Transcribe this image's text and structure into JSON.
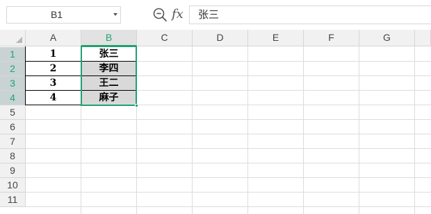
{
  "formula_bar": {
    "name_box": "B1",
    "zoom_icon": "zoom-icon",
    "fx_label": "fx",
    "formula_value": "张三"
  },
  "columns": [
    "A",
    "B",
    "C",
    "D",
    "E",
    "F",
    "G"
  ],
  "selected_column": "B",
  "rows": [
    "1",
    "2",
    "3",
    "4",
    "5",
    "6",
    "7",
    "8",
    "9",
    "10",
    "11"
  ],
  "selected_rows": [
    "1",
    "2",
    "3",
    "4"
  ],
  "cells": {
    "A1": "1",
    "B1": "张三",
    "A2": "2",
    "B2": "李四",
    "A3": "3",
    "B3": "王二",
    "A4": "4",
    "B4": "麻子"
  },
  "colors": {
    "accent": "#20a170",
    "header_bg": "#f1f1f1",
    "gridline": "#dcdcdc",
    "cell_fill": "#d9d9d9"
  }
}
